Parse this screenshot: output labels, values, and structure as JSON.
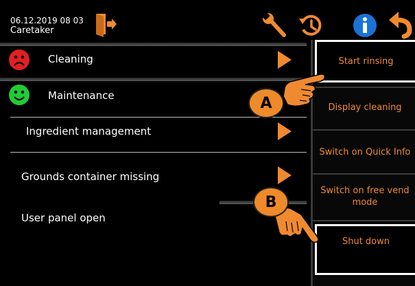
{
  "header": {
    "datetime": "06.12.2019 08 03",
    "role": "Caretaker",
    "icons": [
      "logout-icon",
      "wrench-icon",
      "history-icon",
      "info-icon",
      "back-icon"
    ]
  },
  "list": {
    "cleaning": "Cleaning",
    "maintenance": "Maintenance",
    "ingredient": "Ingredient management",
    "grounds": "Grounds container missing",
    "user_panel": "User panel open"
  },
  "actions": {
    "start_rinsing": "Start rinsing",
    "display_cleaning": "Display cleaning",
    "quick_info": "Switch on Quick Info",
    "free_vend": "Switch on free vend mode",
    "shut_down": "Shut down"
  },
  "callouts": {
    "a": "A",
    "b": "B"
  },
  "colors": {
    "accent": "#f08a30",
    "red": "#e02020",
    "green": "#1fcc36",
    "info_blue": "#1a73d6"
  }
}
